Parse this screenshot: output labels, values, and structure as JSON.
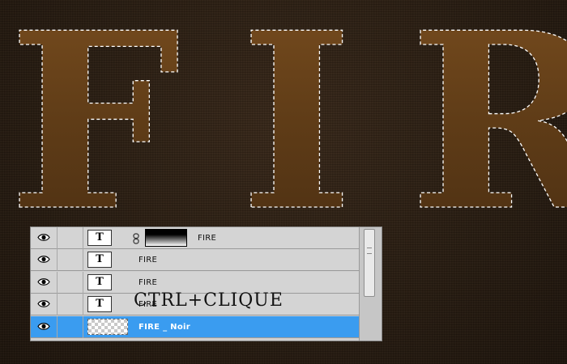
{
  "canvas": {
    "headline": "FIRE",
    "colors": {
      "letter_fill": "#6b4419",
      "letter_edge": "#8d5d27",
      "background": "#2a1c10"
    }
  },
  "layers_panel": {
    "rows": [
      {
        "name": "FIRE",
        "thumb": "T",
        "has_mask": true,
        "selected": false
      },
      {
        "name": "FIRE",
        "thumb": "T",
        "has_mask": false,
        "selected": false
      },
      {
        "name": "FIRE",
        "thumb": "T",
        "has_mask": false,
        "selected": false
      },
      {
        "name": "FIRE",
        "thumb": "T",
        "has_mask": false,
        "selected": false
      },
      {
        "name": "FIRE _ Noir",
        "thumb": "",
        "has_mask": false,
        "selected": true
      }
    ],
    "icons": {
      "visibility": "eye-icon",
      "link": "chain-icon"
    },
    "selection_color": "#3a9cf0"
  },
  "annotation": {
    "text": "CTRL+CLIQUE"
  }
}
